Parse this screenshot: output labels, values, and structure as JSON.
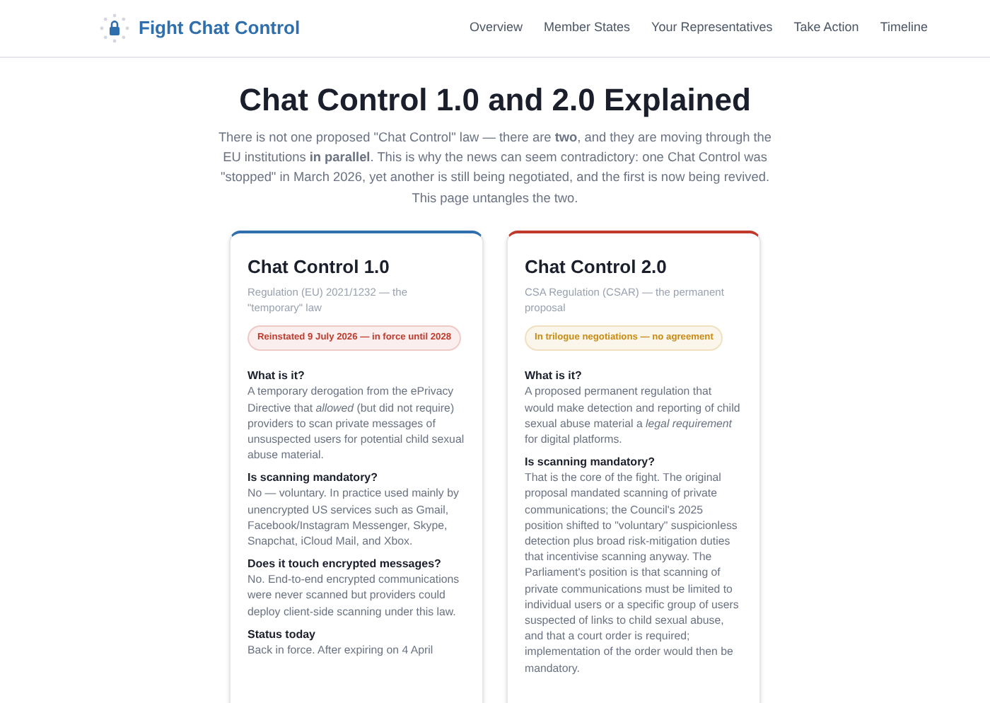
{
  "header": {
    "site_title": "Fight Chat Control",
    "nav": [
      "Overview",
      "Member States",
      "Your Representatives",
      "Take Action",
      "Timeline"
    ]
  },
  "page": {
    "title": "Chat Control 1.0 and 2.0 Explained",
    "intro": "There is not one proposed \"Chat Control\" law — there are **two**, and they are moving through the EU institutions **in parallel**. This is why the news can seem contradictory: one Chat Control was \"stopped\" in March 2026, yet another is still being negotiated, and the first is now being revived. This page untangles the two."
  },
  "cards": [
    {
      "title": "Chat Control 1.0",
      "subtitle": "Regulation (EU) 2021/1232 — the \"temporary\" law",
      "color": "#2f6fad",
      "badge": {
        "text": "Reinstated 9 July 2026 — in force until 2028",
        "color": "#c0392b"
      },
      "sections": [
        {
          "heading": "What is it?",
          "text": "A temporary derogation from the ePrivacy Directive that *allowed* (but did not require) providers to scan private messages of unsuspected users for potential child sexual abuse material."
        },
        {
          "heading": "Is scanning mandatory?",
          "text": "No — voluntary. In practice used mainly by unencrypted US services such as Gmail, Facebook/Instagram Messenger, Skype, Snapchat, iCloud Mail, and Xbox."
        },
        {
          "heading": "Does it touch encrypted messages?",
          "text": "No. End-to-end encrypted communications were never scanned but providers could deploy client-side scanning under this law."
        },
        {
          "heading": "Status today",
          "text": "Back in force. After expiring on 4 April"
        }
      ]
    },
    {
      "title": "Chat Control 2.0",
      "subtitle": "CSA Regulation (CSAR) — the permanent proposal",
      "color": "#c0392b",
      "badge": {
        "text": "In trilogue negotiations — no agreement",
        "color": "#c98a12"
      },
      "sections": [
        {
          "heading": "What is it?",
          "text": "A proposed permanent regulation that would make detection and reporting of child sexual abuse material a *legal requirement* for digital platforms."
        },
        {
          "heading": "Is scanning mandatory?",
          "text": "That is the core of the fight. The original proposal mandated scanning of private communications; the Council's 2025 position shifted to \"voluntary\" suspicionless detection plus broad risk-mitigation duties that incentivise scanning anyway. The Parliament's position is that scanning of private communications must be limited to individual users or a specific group of users suspected of links to child sexual abuse, and that a court order is required; implementation of the order would then be mandatory."
        }
      ]
    }
  ]
}
